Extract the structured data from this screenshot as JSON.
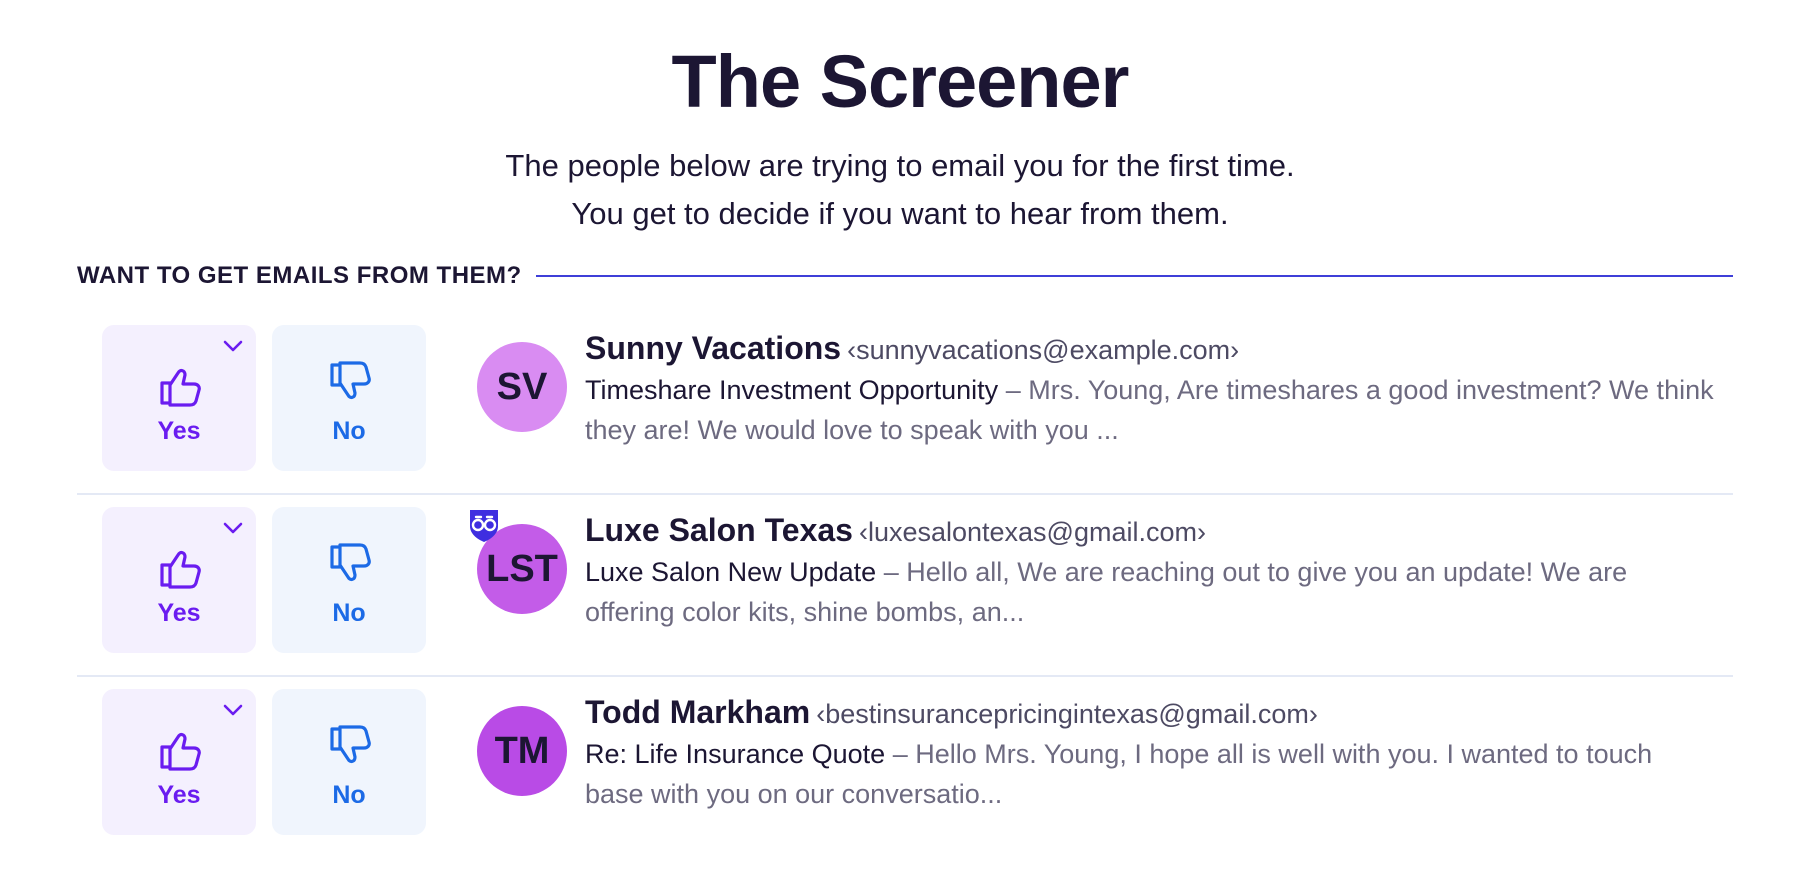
{
  "header": {
    "title": "The Screener",
    "subtitle_line1": "The people below are trying to email you for the first time.",
    "subtitle_line2": "You get to decide if you want to hear from them."
  },
  "section": {
    "label": "WANT TO GET EMAILS FROM THEM?"
  },
  "colors": {
    "accent_rule": "#3f3fd8",
    "yes_text": "#6a1cf0",
    "no_text": "#1c6ae6",
    "yes_bg": "#f4f0fe",
    "no_bg": "#f0f5fd"
  },
  "senders": [
    {
      "initials": "SV",
      "avatar_color": "#d98cf2",
      "name": "Sunny Vacations",
      "email": "‹sunnyvacations@example.com›",
      "subject": "Timeshare Investment Opportunity",
      "separator": " – ",
      "snippet": "Mrs. Young, Are timeshares a good investment? We think they are! We would love to speak with you ...",
      "yes_label": "Yes",
      "no_label": "No",
      "badge": false
    },
    {
      "initials": "LST",
      "avatar_color": "#c35ce8",
      "name": "Luxe Salon Texas",
      "email": "‹luxesalontexas@gmail.com›",
      "subject": "Luxe Salon New Update",
      "separator": " – ",
      "snippet": "Hello all, We are reaching out to give you an update! We are offering color kits, shine bombs, an...",
      "yes_label": "Yes",
      "no_label": "No",
      "badge": true,
      "badge_icon": "spy-binoculars-shield-icon"
    },
    {
      "initials": "TM",
      "avatar_color": "#b94be6",
      "name": "Todd Markham",
      "email": "‹bestinsurancepricingintexas@gmail.com›",
      "subject": "Re: Life Insurance Quote",
      "separator": " – ",
      "snippet": "Hello Mrs. Young, I hope all is well with you. I wanted to touch base with you on our conversatio...",
      "yes_label": "Yes",
      "no_label": "No",
      "badge": false
    }
  ]
}
